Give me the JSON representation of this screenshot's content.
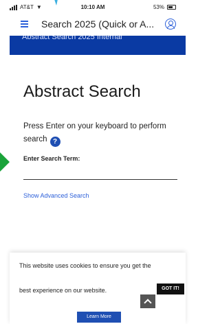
{
  "status_bar": {
    "carrier": "AT&T",
    "time": "10:10 AM",
    "battery": "53%"
  },
  "nav": {
    "title": "Search 2025 (Quick or A..."
  },
  "banner": {
    "text": "Abstract Search 2025 Internal"
  },
  "main": {
    "title": "Abstract Search",
    "instruction": "Press Enter on your keyboard to perform search",
    "help_icon_glyph": "?",
    "field_label": "Enter Search Term:",
    "search_value": "",
    "advanced_link": "Show Advanced Search"
  },
  "cookie": {
    "line1": "This website uses cookies to ensure you get the",
    "line2": "best experience on our website.",
    "got_it": "GOT IT!",
    "learn_more": "Learn More"
  },
  "colors": {
    "accent": "#2b5fd9",
    "banner": "#0a3aa3",
    "help_icon": "#1f4fb3"
  },
  "icons": [
    "hamburger-icon",
    "avatar-icon",
    "help-icon",
    "chevron-up-icon",
    "wifi-icon",
    "battery-icon"
  ]
}
